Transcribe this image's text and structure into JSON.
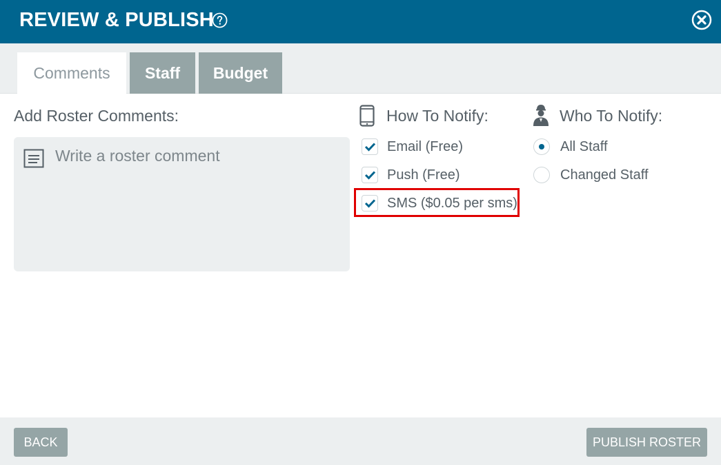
{
  "dialog": {
    "title": "REVIEW & PUBLISH",
    "header_color": "#00658f"
  },
  "tabs": [
    {
      "label": "Comments",
      "active": true
    },
    {
      "label": "Staff",
      "active": false
    },
    {
      "label": "Budget",
      "active": false
    }
  ],
  "comments": {
    "label": "Add Roster Comments:",
    "placeholder": "Write a roster comment",
    "value": ""
  },
  "how_to_notify": {
    "label": "How To Notify:",
    "icon": "phone-icon",
    "options": [
      {
        "label": "Email (Free)",
        "checked": true
      },
      {
        "label": "Push (Free)",
        "checked": true
      },
      {
        "label": "SMS ($0.05 per sms)",
        "checked": true
      }
    ]
  },
  "who_to_notify": {
    "label": "Who To Notify:",
    "icon": "staff-icon",
    "options": [
      {
        "label": "All Staff",
        "selected": true
      },
      {
        "label": "Changed Staff",
        "selected": false
      }
    ]
  },
  "footer": {
    "back_label": "BACK",
    "publish_label": "PUBLISH ROSTER"
  },
  "colors": {
    "accent": "#00658f",
    "button": "#95a5a6",
    "highlight": "#e00000"
  }
}
